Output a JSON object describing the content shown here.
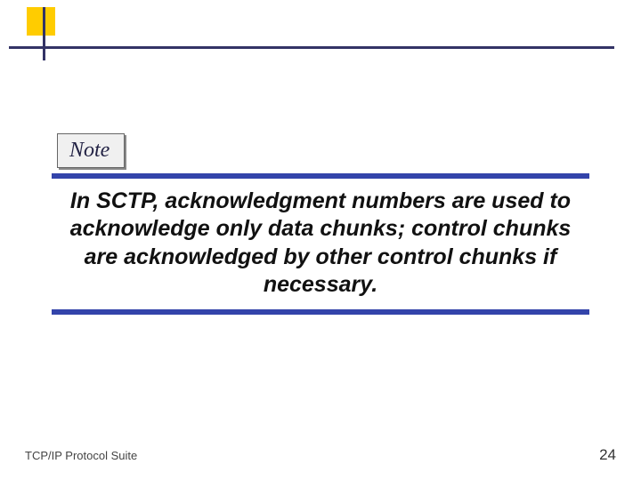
{
  "note": {
    "label": "Note",
    "body": "In SCTP, acknowledgment numbers are used to acknowledge only data chunks; control chunks are acknowledged by other control chunks if necessary."
  },
  "footer": {
    "source": "TCP/IP Protocol Suite",
    "page": "24"
  }
}
